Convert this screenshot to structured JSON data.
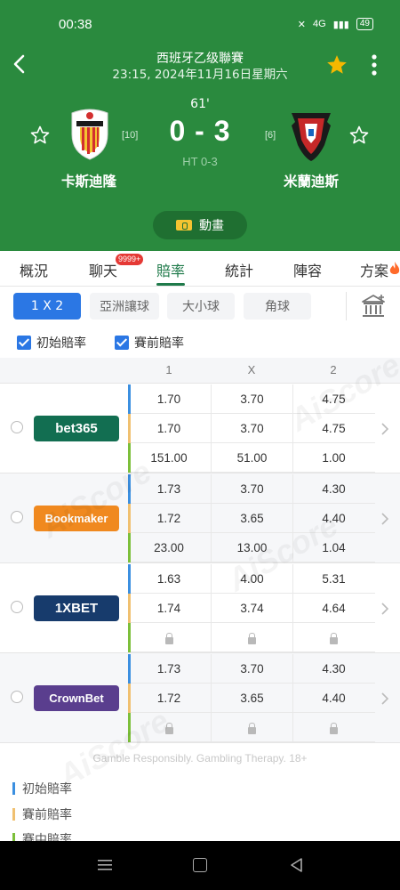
{
  "status_bar": {
    "time": "00:38",
    "network": "4G",
    "battery": "49"
  },
  "header": {
    "league": "西班牙乙级聯賽",
    "kickoff": "23:15, 2024年11月16日星期六",
    "minute": "61'",
    "score": "0 - 3",
    "half_time": "HT 0-3",
    "home": {
      "name": "卡斯迪隆",
      "rank": "[10]"
    },
    "away": {
      "name": "米蘭迪斯",
      "rank": "[6]"
    },
    "animation_label": "動畫"
  },
  "tabs": {
    "items": [
      "概況",
      "聊天",
      "賠率",
      "統計",
      "陣容",
      "方案"
    ],
    "active": "賠率",
    "chat_badge": "9999+"
  },
  "filters": {
    "items": [
      "1 X 2",
      "亞洲讓球",
      "大小球",
      "角球"
    ],
    "active": "1 X 2"
  },
  "checkboxes": [
    {
      "label": "初始賠率",
      "checked": true
    },
    {
      "label": "賽前賠率",
      "checked": true
    }
  ],
  "columns": [
    "1",
    "X",
    "2"
  ],
  "bookmakers": [
    {
      "name": "bet365",
      "logo_color": "#126e51",
      "logo_text_color": "#ffffff",
      "rows": [
        [
          "1.70",
          "3.70",
          "4.75"
        ],
        [
          "1.70",
          "3.70",
          "4.75"
        ],
        [
          "151.00",
          "51.00",
          "1.00"
        ]
      ]
    },
    {
      "name": "Bookmaker",
      "logo_color": "#f0891f",
      "logo_text_color": "#ffffff",
      "rows": [
        [
          "1.73",
          "3.70",
          "4.30"
        ],
        [
          "1.72",
          "3.65",
          "4.40"
        ],
        [
          "23.00",
          "13.00",
          "1.04"
        ]
      ]
    },
    {
      "name": "1XBET",
      "logo_color": "#173b6c",
      "logo_text_color": "#ffffff",
      "rows": [
        [
          "1.63",
          "4.00",
          "5.31"
        ],
        [
          "1.74",
          "3.74",
          "4.64"
        ],
        [
          "",
          "",
          ""
        ]
      ]
    },
    {
      "name": "CrownBet",
      "logo_color": "#5a3e8e",
      "logo_text_color": "#ffffff",
      "rows": [
        [
          "1.73",
          "3.70",
          "4.30"
        ],
        [
          "1.72",
          "3.65",
          "4.40"
        ],
        [
          "",
          "",
          ""
        ]
      ]
    }
  ],
  "row_colors": [
    "#3b8fe0",
    "#f0c070",
    "#7cbf3a"
  ],
  "disclaimer": "Gamble Responsibly. Gambling Therapy. 18+",
  "legend": [
    {
      "label": "初始賠率",
      "color": "#3b8fe0"
    },
    {
      "label": "賽前賠率",
      "color": "#f0c070"
    },
    {
      "label": "賽中賠率",
      "color": "#7cbf3a"
    }
  ],
  "watermark": "AiScore",
  "colors": {
    "header_green": "#2a8a3e",
    "accent_blue": "#2b77e4",
    "tab_active": "#1f7a4a",
    "star": "#f5b800"
  },
  "icons": [
    "back-arrow-icon",
    "star-filled-icon",
    "more-vert-icon",
    "star-outline-icon",
    "fire-icon",
    "bank-icon",
    "chevron-right-icon",
    "lock-icon"
  ]
}
